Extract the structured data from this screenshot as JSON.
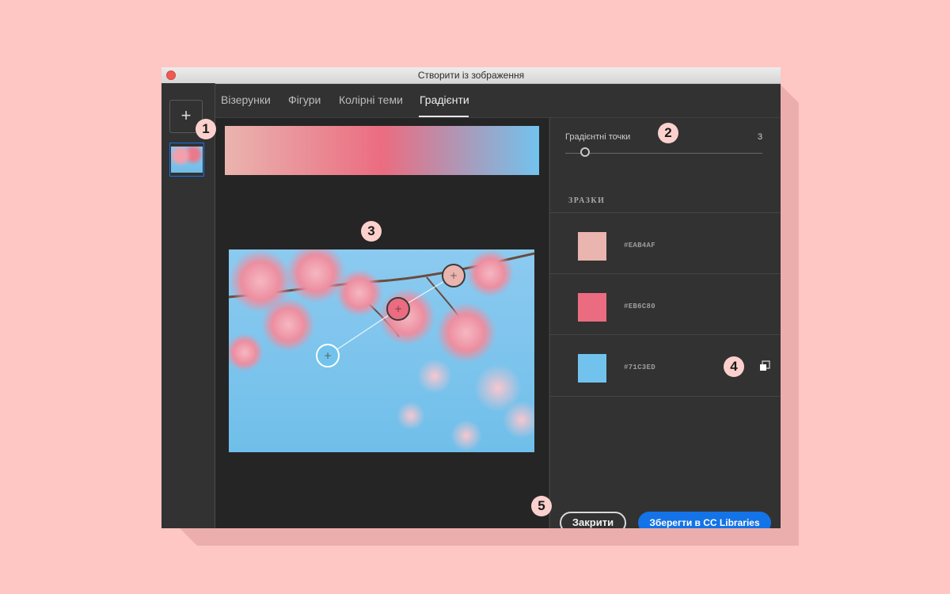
{
  "window": {
    "title": "Створити із зображення"
  },
  "tabs": [
    {
      "label": "Візерунки"
    },
    {
      "label": "Фігури"
    },
    {
      "label": "Колірні теми"
    },
    {
      "label": "Градієнти",
      "active": true
    }
  ],
  "sidebar": {
    "add_label": "+"
  },
  "gradient": {
    "colors": [
      "#EAB4AF",
      "#EB6C80",
      "#71C3ED"
    ]
  },
  "panel": {
    "stops_label": "Градієнтні точки",
    "stops_value": "3",
    "samples_heading": "ЗРАЗКИ",
    "swatches": [
      {
        "hex": "#EAB4AF",
        "color": "#eab4af"
      },
      {
        "hex": "#EB6C80",
        "color": "#eb6c80"
      },
      {
        "hex": "#71C3ED",
        "color": "#71c3ed"
      }
    ]
  },
  "buttons": {
    "close_label": "Закрити",
    "save_label": "Зберегти в CC Libraries"
  },
  "callouts": [
    "1",
    "2",
    "3",
    "4",
    "5"
  ],
  "colors": {
    "background": "#fec7c3",
    "accent": "#1473e6",
    "callout": "#fcd1cd"
  }
}
